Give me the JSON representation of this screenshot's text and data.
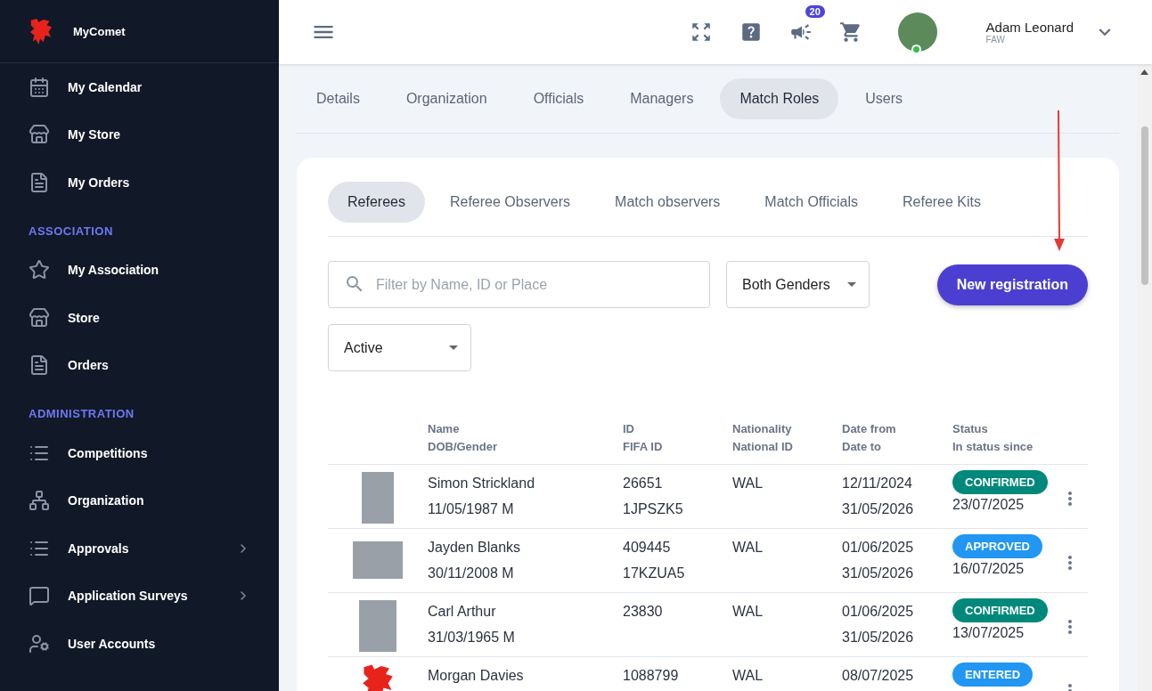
{
  "sidebar": {
    "brand": "MyComet",
    "sections": [
      {
        "items": [
          {
            "label": "My Calendar",
            "has_submenu": false
          },
          {
            "label": "My Store",
            "has_submenu": false
          },
          {
            "label": "My Orders",
            "has_submenu": false
          }
        ]
      },
      {
        "heading": "ASSOCIATION",
        "items": [
          {
            "label": "My Association",
            "has_submenu": false
          },
          {
            "label": "Store",
            "has_submenu": false
          },
          {
            "label": "Orders",
            "has_submenu": false
          }
        ]
      },
      {
        "heading": "ADMINISTRATION",
        "items": [
          {
            "label": "Competitions",
            "has_submenu": false
          },
          {
            "label": "Organization",
            "has_submenu": false
          },
          {
            "label": "Approvals",
            "has_submenu": true
          },
          {
            "label": "Application Surveys",
            "has_submenu": true
          },
          {
            "label": "User Accounts",
            "has_submenu": false
          }
        ]
      }
    ]
  },
  "header": {
    "notifications": "20",
    "user": {
      "name": "Adam Leonard",
      "org": "FAW",
      "online": true
    }
  },
  "tabs": [
    {
      "label": "Details",
      "selected": false
    },
    {
      "label": "Organization",
      "selected": false
    },
    {
      "label": "Officials",
      "selected": false
    },
    {
      "label": "Managers",
      "selected": false
    },
    {
      "label": "Match Roles",
      "selected": true
    },
    {
      "label": "Users",
      "selected": false
    }
  ],
  "subtabs": [
    {
      "label": "Referees",
      "selected": true
    },
    {
      "label": "Referee Observers",
      "selected": false
    },
    {
      "label": "Match observers",
      "selected": false
    },
    {
      "label": "Match Officials",
      "selected": false
    },
    {
      "label": "Referee Kits",
      "selected": false
    }
  ],
  "filters": {
    "search": {
      "placeholder": "Filter by Name, ID or Place"
    },
    "gender": "Both Genders",
    "status": "Active",
    "new_button": "New registration"
  },
  "table": {
    "columns": [
      [
        "Name",
        "DOB/Gender"
      ],
      [
        "ID",
        "FIFA ID"
      ],
      [
        "Nationality",
        "National ID"
      ],
      [
        "Date from",
        "Date to"
      ],
      [
        "Status",
        "In status since"
      ]
    ],
    "rows": [
      {
        "kind": "photo",
        "name": "Simon Strickland",
        "dob": "11/05/1987 M",
        "id": "26651",
        "fifa_id": "1JPSZK5",
        "nationality": "WAL",
        "date_from": "12/11/2024",
        "date_to": "31/05/2026",
        "status": "CONFIRMED",
        "color": "#00897b",
        "status_since": "23/07/2025"
      },
      {
        "kind": "photo",
        "name": "Jayden Blanks",
        "dob": "30/11/2008 M",
        "id": "409445",
        "fifa_id": "17KZUA5",
        "nationality": "WAL",
        "date_from": "01/06/2025",
        "date_to": "31/05/2026",
        "status": "APPROVED",
        "color": "#2196f3",
        "status_since": "16/07/2025"
      },
      {
        "kind": "photo",
        "name": "Carl Arthur",
        "dob": "31/03/1965 M",
        "id": "23830",
        "nationality": "WAL",
        "date_from": "01/06/2025",
        "date_to": "31/05/2026",
        "status": "CONFIRMED",
        "color": "#00897b",
        "status_since": "13/07/2025"
      },
      {
        "kind": "logo",
        "name": "Morgan Davies",
        "id": "1088799",
        "nationality": "WAL",
        "date_from": "08/07/2025",
        "status": "ENTERED",
        "color": "#2196f3"
      }
    ]
  }
}
